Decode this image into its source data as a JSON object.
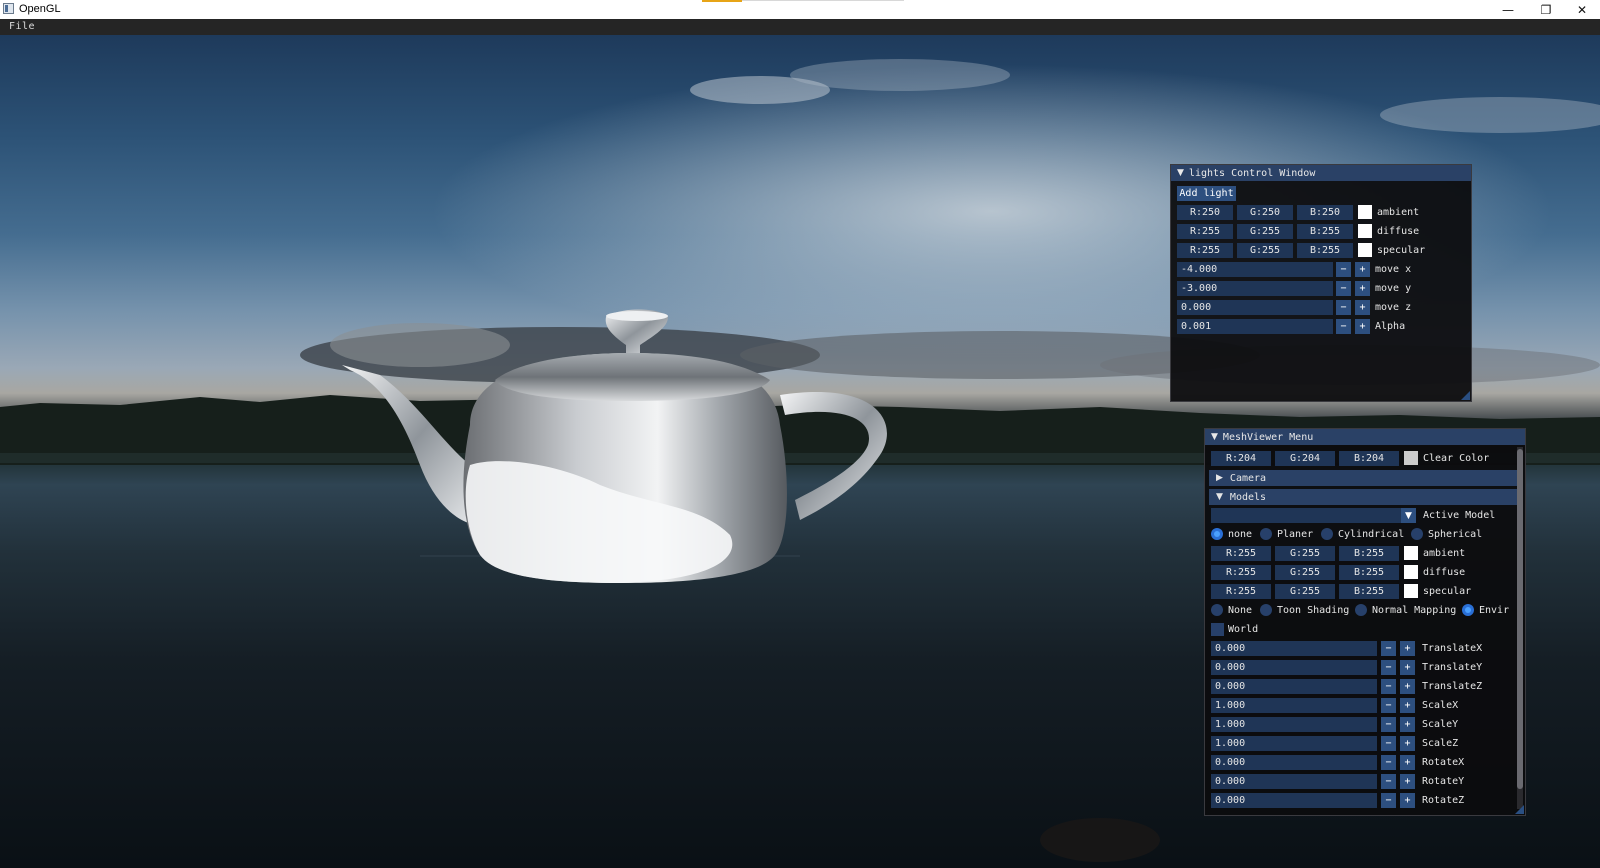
{
  "window": {
    "title": "OpenGL"
  },
  "menu": {
    "file": "File"
  },
  "lights": {
    "title": "lights Control Window",
    "add_light": "Add light",
    "ambient": {
      "r": "R:250",
      "g": "G:250",
      "b": "B:250",
      "label": "ambient"
    },
    "diffuse": {
      "r": "R:255",
      "g": "G:255",
      "b": "B:255",
      "label": "diffuse"
    },
    "specular": {
      "r": "R:255",
      "g": "G:255",
      "b": "B:255",
      "label": "specular"
    },
    "move_x": {
      "value": "-4.000",
      "label": "move x"
    },
    "move_y": {
      "value": "-3.000",
      "label": "move y"
    },
    "move_z": {
      "value": "0.000",
      "label": "move z"
    },
    "alpha": {
      "value": "0.001",
      "label": "Alpha"
    }
  },
  "mesh": {
    "title": "MeshViewer Menu",
    "clear": {
      "r": "R:204",
      "g": "G:204",
      "b": "B:204",
      "label": "Clear Color"
    },
    "camera": "Camera",
    "models": "Models",
    "active_model": "Active Model",
    "mapping": [
      "none",
      "Planer",
      "Cylindrical",
      "Spherical"
    ],
    "ambient": {
      "r": "R:255",
      "g": "G:255",
      "b": "B:255",
      "label": "ambient"
    },
    "diffuse": {
      "r": "R:255",
      "g": "G:255",
      "b": "B:255",
      "label": "diffuse"
    },
    "specular": {
      "r": "R:255",
      "g": "G:255",
      "b": "B:255",
      "label": "specular"
    },
    "shading": [
      "None",
      "Toon Shading",
      "Normal Mapping",
      "Envir"
    ],
    "world": "World",
    "transforms": [
      {
        "value": "0.000",
        "label": "TranslateX"
      },
      {
        "value": "0.000",
        "label": "TranslateY"
      },
      {
        "value": "0.000",
        "label": "TranslateZ"
      },
      {
        "value": "1.000",
        "label": "ScaleX"
      },
      {
        "value": "1.000",
        "label": "ScaleY"
      },
      {
        "value": "1.000",
        "label": "ScaleZ"
      },
      {
        "value": "0.000",
        "label": "RotateX"
      },
      {
        "value": "0.000",
        "label": "RotateY"
      },
      {
        "value": "0.000",
        "label": "RotateZ"
      }
    ]
  },
  "controls": {
    "minus": "−",
    "plus": "+"
  }
}
